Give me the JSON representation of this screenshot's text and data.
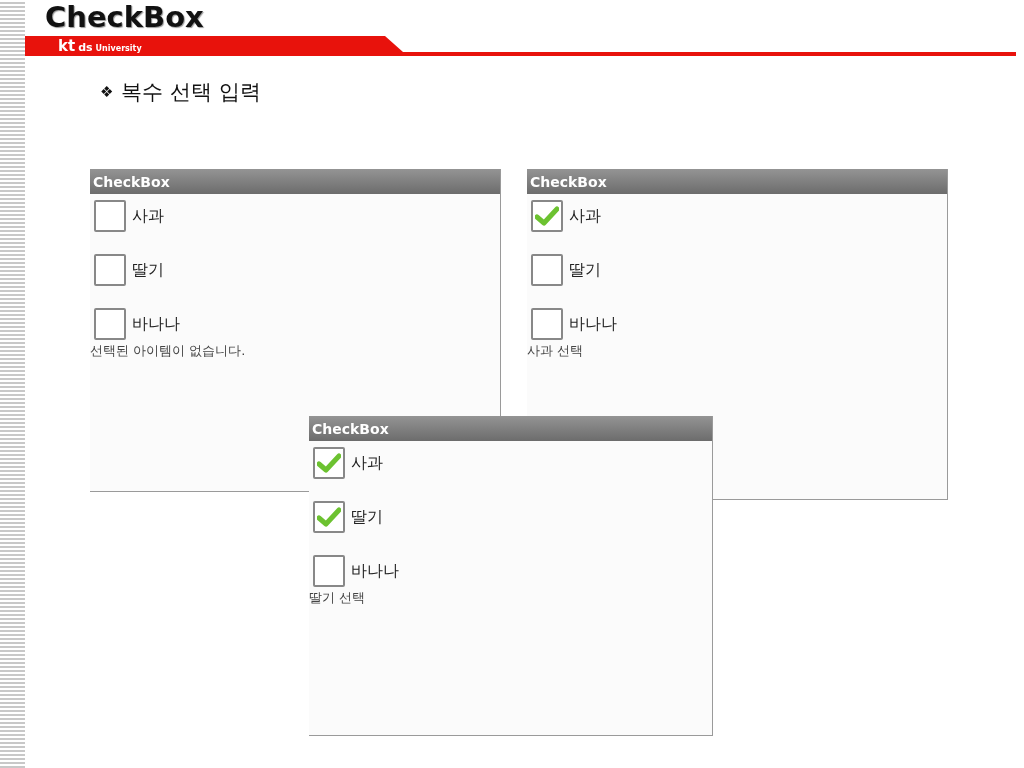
{
  "slide": {
    "title": "CheckBox",
    "logo": {
      "brand": "kt",
      "sub": "ds",
      "tagline": "University"
    },
    "bullet": "❖",
    "heading": "복수 선택 입력"
  },
  "windows": [
    {
      "title": "CheckBox",
      "items": [
        {
          "label": "사과",
          "checked": false
        },
        {
          "label": "딸기",
          "checked": false
        },
        {
          "label": "바나나",
          "checked": false
        }
      ],
      "status": "선택된 아이템이 없습니다."
    },
    {
      "title": "CheckBox",
      "items": [
        {
          "label": "사과",
          "checked": true
        },
        {
          "label": "딸기",
          "checked": false
        },
        {
          "label": "바나나",
          "checked": false
        }
      ],
      "status": "사과 선택"
    },
    {
      "title": "CheckBox",
      "items": [
        {
          "label": "사과",
          "checked": true
        },
        {
          "label": "딸기",
          "checked": true
        },
        {
          "label": "바나나",
          "checked": false
        }
      ],
      "status": "딸기 선택"
    }
  ]
}
